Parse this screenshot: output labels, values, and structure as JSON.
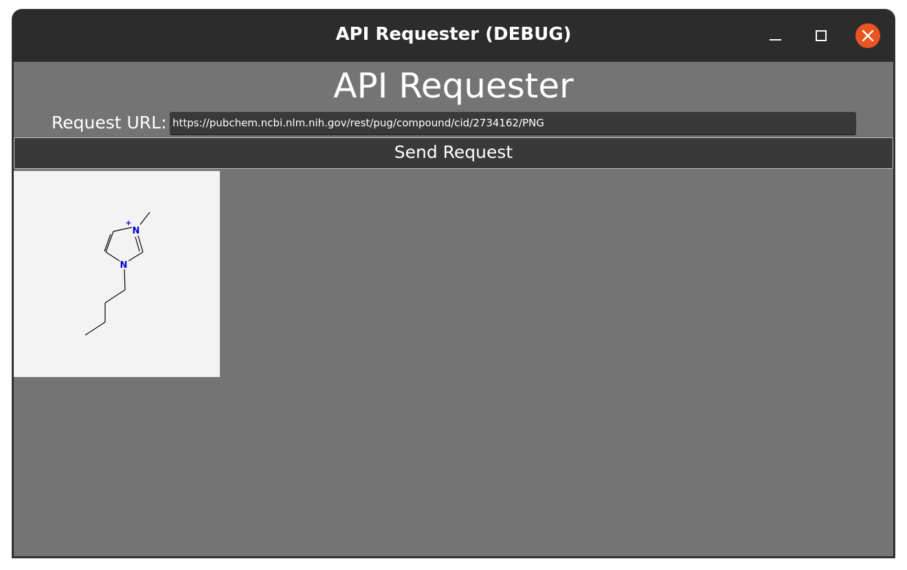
{
  "window": {
    "title": "API Requester (DEBUG)",
    "controls": {
      "minimize_icon": "minimize-icon",
      "maximize_icon": "maximize-icon",
      "close_icon": "close-icon",
      "close_color": "#e95420"
    }
  },
  "main": {
    "heading": "API Requester",
    "url_label": "Request URL:",
    "url_value": "https://pubchem.ncbi.nlm.nih.gov/rest/pug/compound/cid/2734162/PNG",
    "send_button_label": "Send Request"
  },
  "result": {
    "atom_labels": {
      "n_plus": "N",
      "charge": "+",
      "n_lower": "N"
    },
    "atom_color": "#0000d0"
  }
}
